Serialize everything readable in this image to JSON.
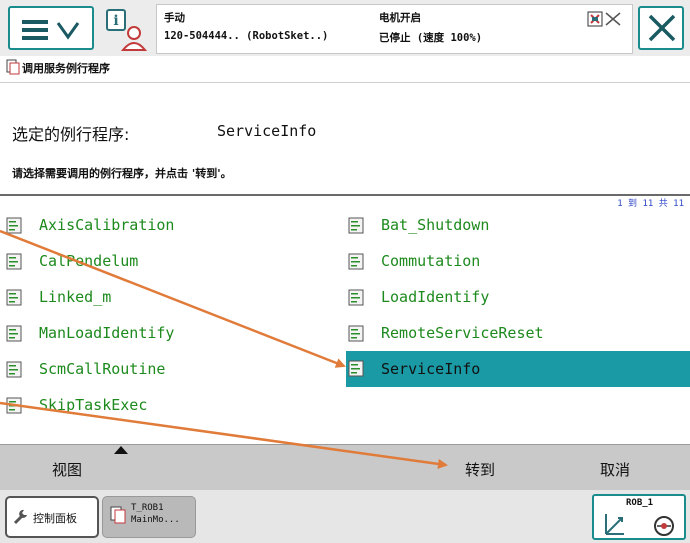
{
  "status": {
    "mode": "手动",
    "controller": "120-504444.. (RobotSket..)",
    "motors": "电机开启",
    "state": "已停止 (速度 100%)"
  },
  "breadcrumb": {
    "title": "调用服务例行程序",
    "icon": "routine-doc-icon"
  },
  "selected": {
    "label": "选定的例行程序:",
    "value": "ServiceInfo"
  },
  "hint": "请选择需要调用的例行程序，并点击 '转到'。",
  "list_count": "1 到 11 共 11",
  "routines": [
    {
      "label": "AxisCalibration"
    },
    {
      "label": "Bat_Shutdown"
    },
    {
      "label": "CalPendelum"
    },
    {
      "label": "Commutation"
    },
    {
      "label": "Linked_m"
    },
    {
      "label": "LoadIdentify"
    },
    {
      "label": "ManLoadIdentify"
    },
    {
      "label": "RemoteServiceReset"
    },
    {
      "label": "ScmCallRoutine"
    },
    {
      "label": "ServiceInfo",
      "selected": true
    },
    {
      "label": "SkipTaskExec"
    }
  ],
  "actions": {
    "view": "视图",
    "goto": "转到",
    "cancel": "取消"
  },
  "taskbar": {
    "control_panel": "控制面板",
    "task_line1": "T_ROB1",
    "task_line2": "MainMo..."
  },
  "mechanical_unit": "ROB_1",
  "colors": {
    "accent": "#1b8c8e",
    "selected_row": "#1a9aa4",
    "routine_text": "#1d8a1d",
    "annotation_arrow": "#e07b39"
  }
}
